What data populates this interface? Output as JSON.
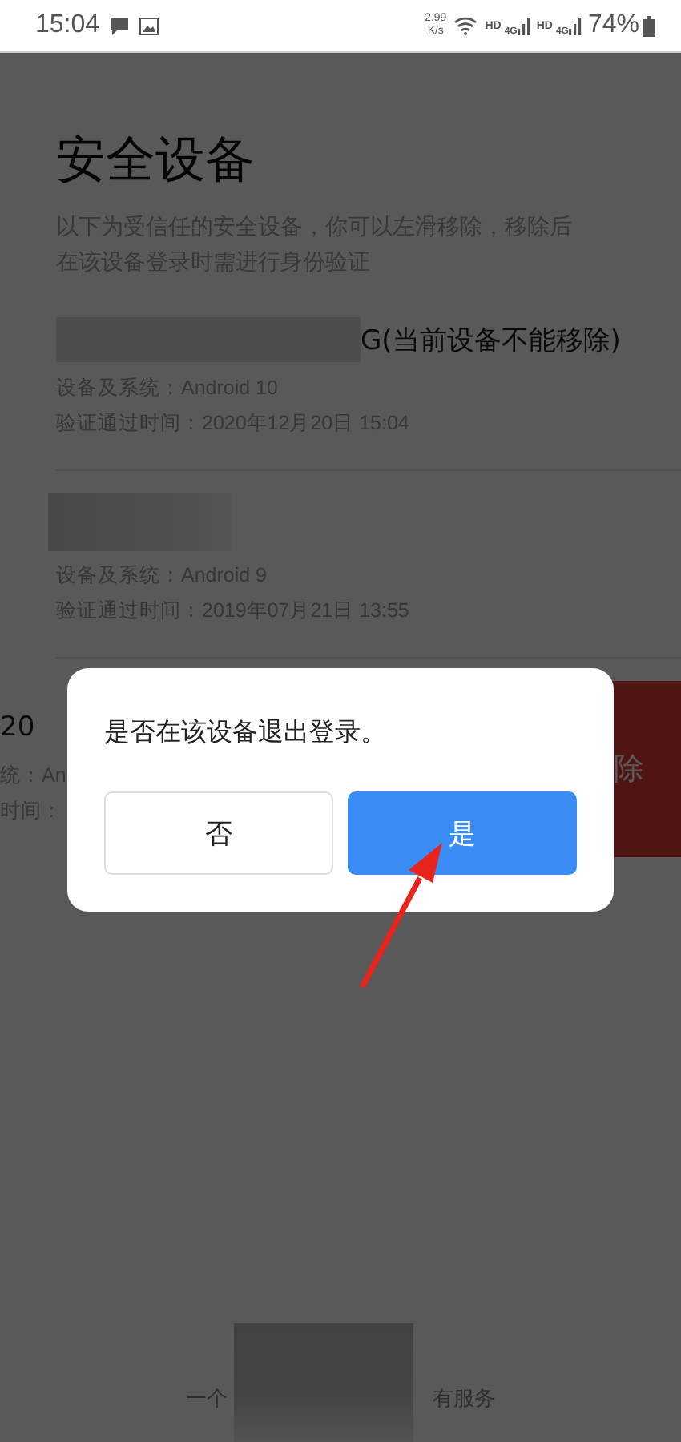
{
  "status_bar": {
    "time": "15:04",
    "speed_value": "2.99",
    "speed_unit": "K/s",
    "sims": [
      {
        "hd": "HD",
        "net": "4G"
      },
      {
        "hd": "HD",
        "net": "4G"
      }
    ],
    "battery": "74%"
  },
  "page": {
    "title": "安全设备",
    "description": "以下为受信任的安全设备，你可以左滑移除，移除后在该设备登录时需进行身份验证",
    "devices": [
      {
        "name": "G(当前设备不能移除)",
        "system": "设备及系统：Android 10",
        "verified": "验证通过时间：2020年12月20日 15:04",
        "swiped": false
      },
      {
        "system": "设备及系统：Android 9",
        "verified": "验证通过时间：2019年07月21日 13:55",
        "swiped": false
      },
      {
        "name": "20",
        "system": "统：An",
        "verified": "时间：",
        "swiped": true,
        "action": "除"
      }
    ],
    "footer": [
      "一个",
      "有服务"
    ]
  },
  "dialog": {
    "message": "是否在该设备退出登录。",
    "buttons": [
      {
        "label": "否",
        "primary": false
      },
      {
        "label": "是",
        "primary": true
      }
    ]
  }
}
